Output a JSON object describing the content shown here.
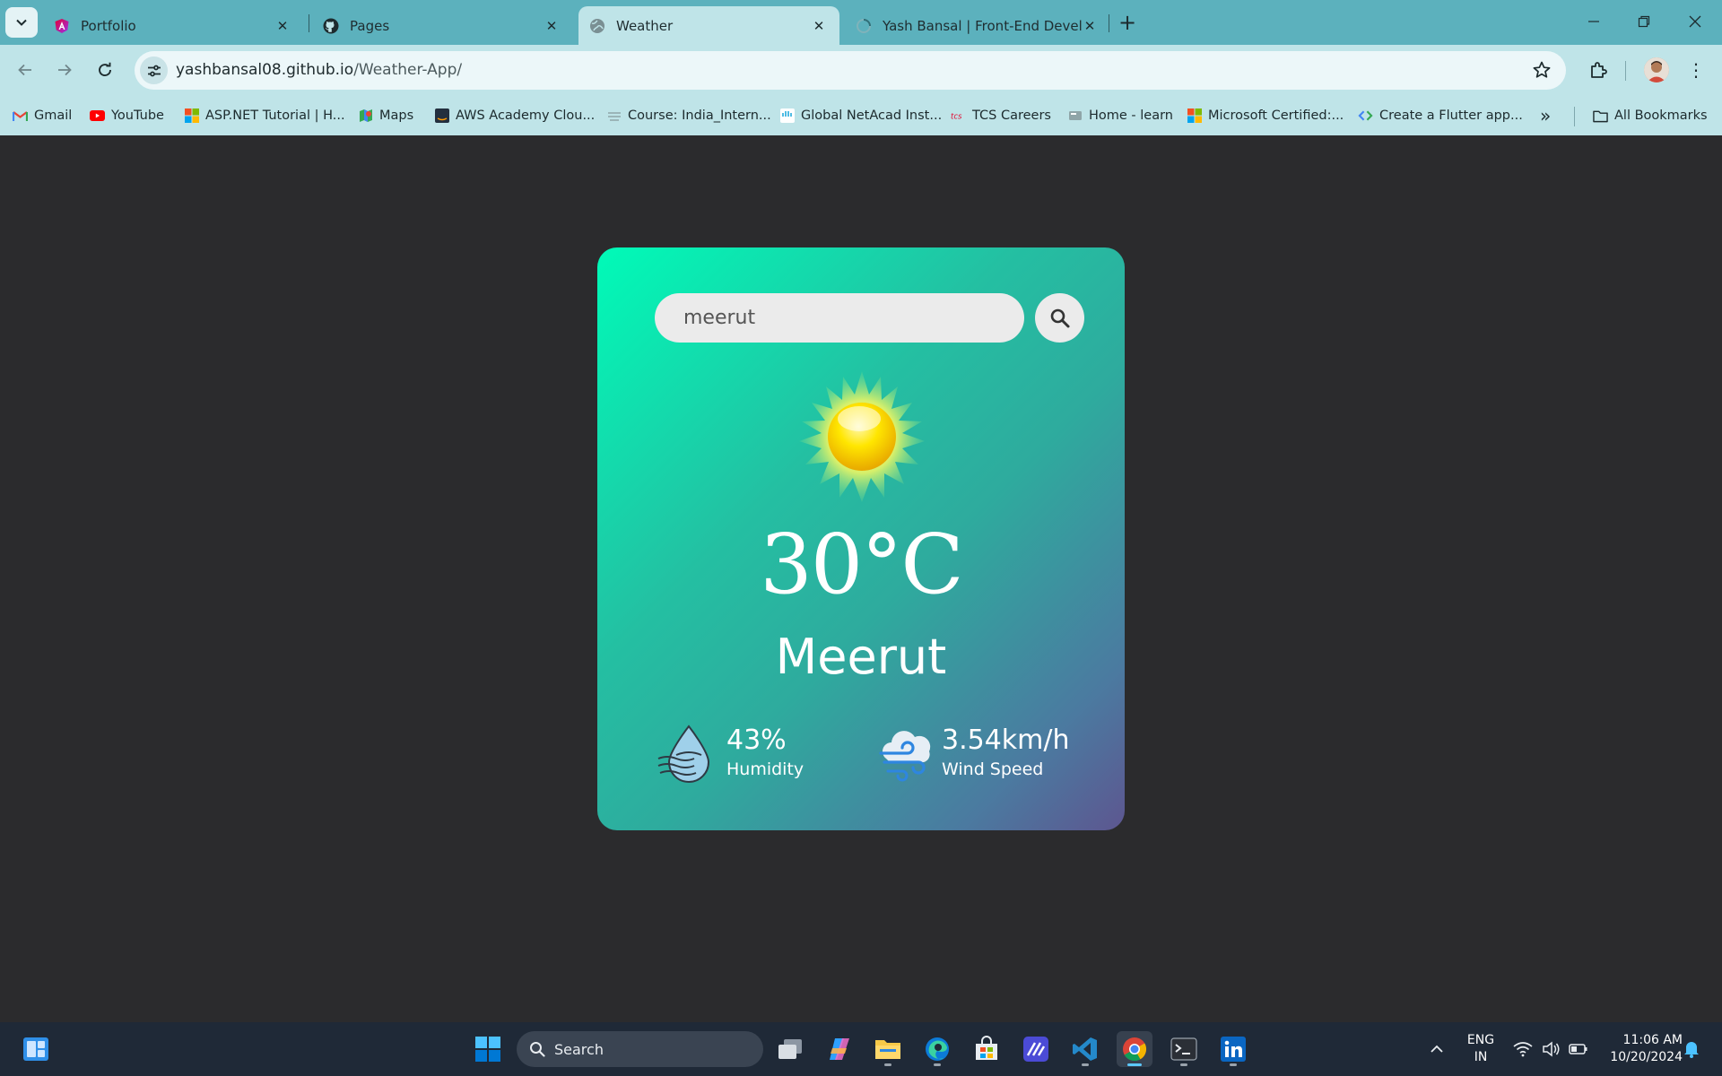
{
  "browser": {
    "tabs": [
      {
        "title": "Portfolio",
        "icon": "angular-icon"
      },
      {
        "title": "Pages",
        "icon": "github-icon"
      },
      {
        "title": "Weather",
        "icon": "globe-icon",
        "active": true
      },
      {
        "title": "Yash Bansal | Front-End Develop",
        "icon": "loading-icon"
      }
    ],
    "address": {
      "host": "yashbansal08.github.io",
      "path": "/Weather-App/"
    },
    "bookmarks": [
      {
        "label": "Gmail",
        "icon": "gmail-icon"
      },
      {
        "label": "YouTube",
        "icon": "youtube-icon"
      },
      {
        "label": "ASP.NET Tutorial | H...",
        "icon": "microsoft-icon"
      },
      {
        "label": "Maps",
        "icon": "maps-icon"
      },
      {
        "label": "AWS Academy Clou...",
        "icon": "aws-icon"
      },
      {
        "label": "Course: India_Intern...",
        "icon": "course-icon"
      },
      {
        "label": "Global NetAcad Inst...",
        "icon": "cisco-icon"
      },
      {
        "label": "TCS Careers",
        "icon": "tcs-icon"
      },
      {
        "label": "Home - learn",
        "icon": "learn-icon"
      },
      {
        "label": "Microsoft Certified:...",
        "icon": "microsoft-icon"
      },
      {
        "label": "Create a Flutter app...",
        "icon": "flutter-icon"
      }
    ],
    "all_bookmarks_label": "All Bookmarks"
  },
  "weather": {
    "search_value": "meerut",
    "temperature": "30°C",
    "city": "Meerut",
    "humidity_value": "43%",
    "humidity_label": "Humidity",
    "wind_value": "3.54km/h",
    "wind_label": "Wind Speed",
    "condition_icon": "sun-icon"
  },
  "taskbar": {
    "search_label": "Search",
    "language": "ENG",
    "region": "IN",
    "time": "11:06 AM",
    "date": "10/20/2024"
  },
  "colors": {
    "page_background": "#2b2b2d",
    "chrome_tabstrip": "#5cb1bd",
    "chrome_toolbar": "#bfe4e8",
    "card_gradient_start": "#00fbb8",
    "card_gradient_end": "#5d5690"
  }
}
